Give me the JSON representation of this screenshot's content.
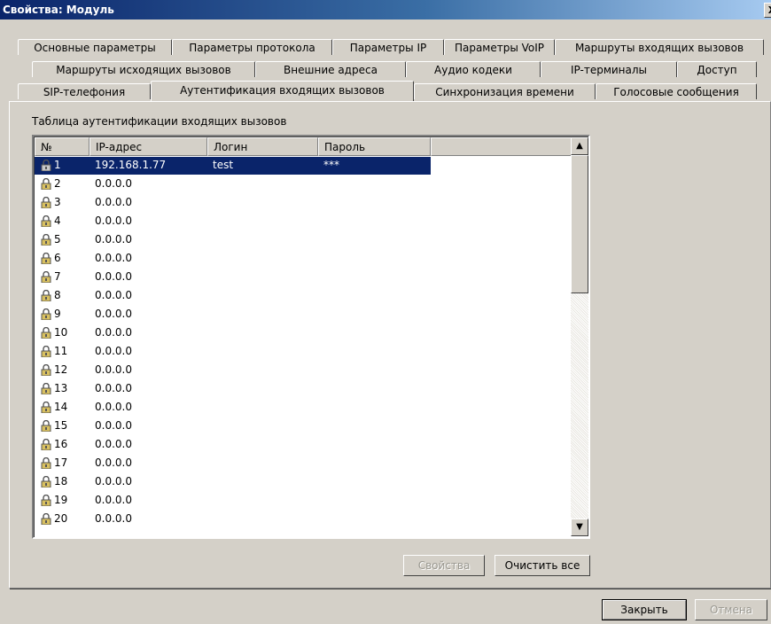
{
  "window": {
    "title": "Свойства: Модуль",
    "close_glyph": "X"
  },
  "tabs": {
    "row1": [
      "Основные параметры",
      "Параметры протокола",
      "Параметры IP",
      "Параметры VoIP",
      "Маршруты входящих вызовов"
    ],
    "row2": [
      "Маршруты исходящих вызовов",
      "Внешние адреса",
      "Аудио кодеки",
      "IP-терминалы",
      "Доступ"
    ],
    "row3": [
      "SIP-телефония",
      "Аутентификация входящих вызовов",
      "Синхронизация времени",
      "Голосовые сообщения"
    ],
    "active": "Аутентификация входящих вызовов"
  },
  "table": {
    "caption": "Таблица аутентификации входящих вызовов",
    "columns": [
      "№",
      "IP-адрес",
      "Логин",
      "Пароль"
    ],
    "rows": [
      {
        "num": "1",
        "ip": "192.168.1.77",
        "login": "test",
        "password": "***",
        "selected": true
      },
      {
        "num": "2",
        "ip": "0.0.0.0",
        "login": "",
        "password": ""
      },
      {
        "num": "3",
        "ip": "0.0.0.0",
        "login": "",
        "password": ""
      },
      {
        "num": "4",
        "ip": "0.0.0.0",
        "login": "",
        "password": ""
      },
      {
        "num": "5",
        "ip": "0.0.0.0",
        "login": "",
        "password": ""
      },
      {
        "num": "6",
        "ip": "0.0.0.0",
        "login": "",
        "password": ""
      },
      {
        "num": "7",
        "ip": "0.0.0.0",
        "login": "",
        "password": ""
      },
      {
        "num": "8",
        "ip": "0.0.0.0",
        "login": "",
        "password": ""
      },
      {
        "num": "9",
        "ip": "0.0.0.0",
        "login": "",
        "password": ""
      },
      {
        "num": "10",
        "ip": "0.0.0.0",
        "login": "",
        "password": ""
      },
      {
        "num": "11",
        "ip": "0.0.0.0",
        "login": "",
        "password": ""
      },
      {
        "num": "12",
        "ip": "0.0.0.0",
        "login": "",
        "password": ""
      },
      {
        "num": "13",
        "ip": "0.0.0.0",
        "login": "",
        "password": ""
      },
      {
        "num": "14",
        "ip": "0.0.0.0",
        "login": "",
        "password": ""
      },
      {
        "num": "15",
        "ip": "0.0.0.0",
        "login": "",
        "password": ""
      },
      {
        "num": "16",
        "ip": "0.0.0.0",
        "login": "",
        "password": ""
      },
      {
        "num": "17",
        "ip": "0.0.0.0",
        "login": "",
        "password": ""
      },
      {
        "num": "18",
        "ip": "0.0.0.0",
        "login": "",
        "password": ""
      },
      {
        "num": "19",
        "ip": "0.0.0.0",
        "login": "",
        "password": ""
      },
      {
        "num": "20",
        "ip": "0.0.0.0",
        "login": "",
        "password": ""
      }
    ],
    "row_icon": "lock-icon"
  },
  "buttons": {
    "properties": "Свойства",
    "clear_all": "Очистить все",
    "close": "Закрыть",
    "cancel": "Отмена"
  },
  "colors": {
    "selection": "#0a246a",
    "face": "#d4d0c8",
    "lock_body": "#d8c060"
  }
}
